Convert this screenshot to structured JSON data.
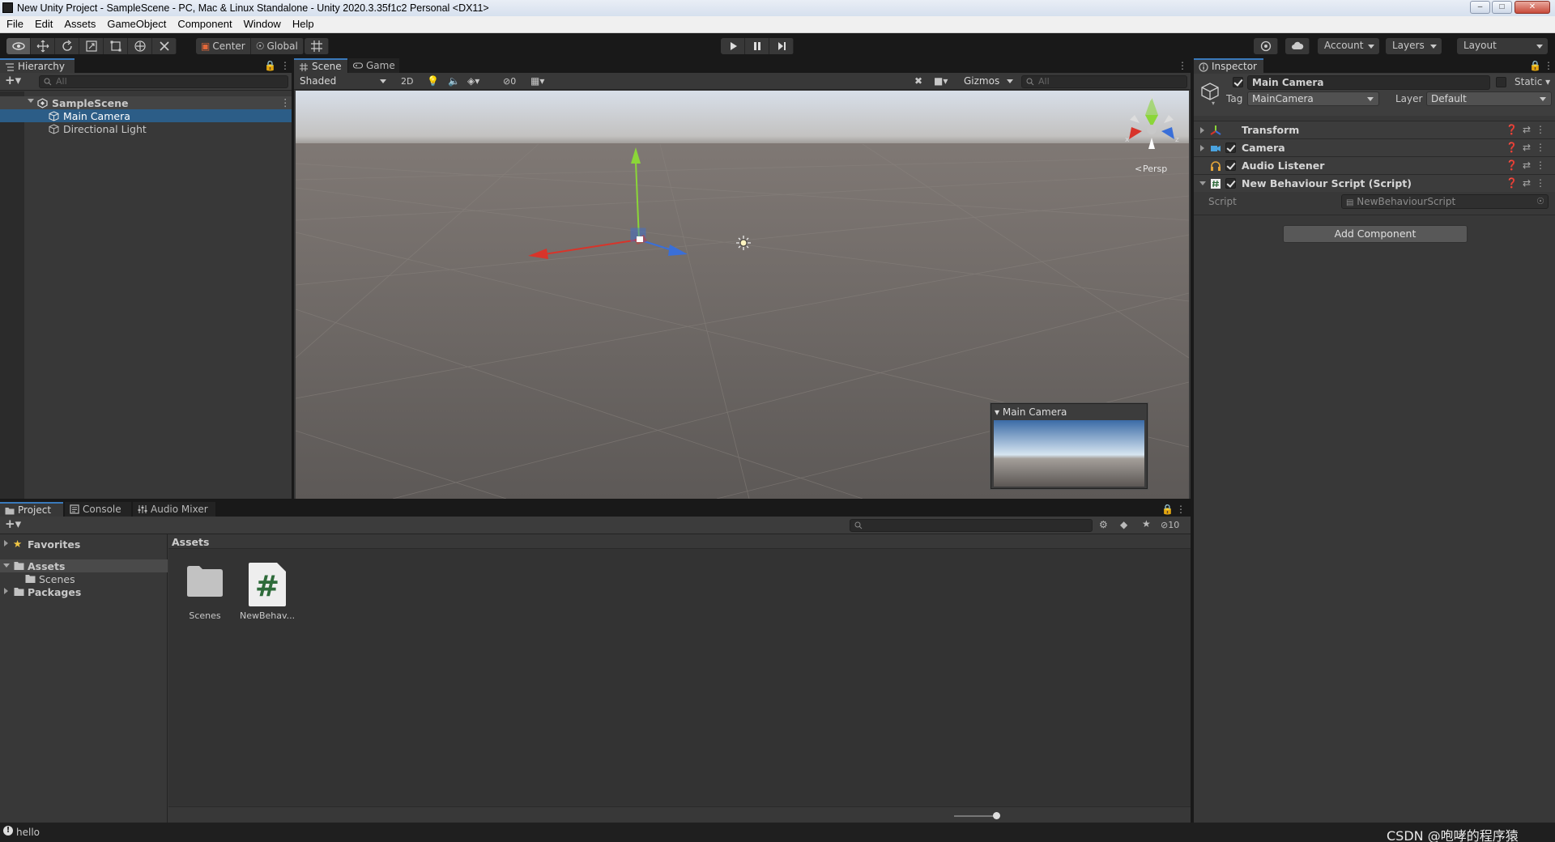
{
  "window": {
    "title": "New Unity Project - SampleScene - PC, Mac & Linux Standalone - Unity 2020.3.35f1c2 Personal <DX11>"
  },
  "menubar": [
    "File",
    "Edit",
    "Assets",
    "GameObject",
    "Component",
    "Window",
    "Help"
  ],
  "toolbar": {
    "pivot_label": "Center",
    "space_label": "Global",
    "account_label": "Account",
    "layers_label": "Layers",
    "layout_label": "Layout"
  },
  "hierarchy": {
    "tab": "Hierarchy",
    "search_placeholder": "All",
    "scene": "SampleScene",
    "items": [
      "Main Camera",
      "Directional Light"
    ],
    "selected": "Main Camera"
  },
  "scene": {
    "tabs": [
      "Scene",
      "Game"
    ],
    "shading": "Shaded",
    "mode_2d": "2D",
    "hidden_count": "0",
    "gizmos": "Gizmos",
    "search_placeholder": "All",
    "projection": "Persp",
    "camera_preview_title": "Main Camera",
    "gizmo_axes": {
      "x": "x",
      "y": "y",
      "z": "z"
    }
  },
  "inspector": {
    "tab": "Inspector",
    "object_name": "Main Camera",
    "static_label": "Static",
    "tag_label": "Tag",
    "tag_value": "MainCamera",
    "layer_label": "Layer",
    "layer_value": "Default",
    "components": [
      "Transform",
      "Camera",
      "Audio Listener",
      "New Behaviour Script (Script)"
    ],
    "script_field_label": "Script",
    "script_field_value": "NewBehaviourScript",
    "add_component": "Add Component"
  },
  "project": {
    "tabs": [
      "Project",
      "Console",
      "Audio Mixer"
    ],
    "hidden_count": "10",
    "tree": {
      "favorites": "Favorites",
      "assets": "Assets",
      "scenes": "Scenes",
      "packages": "Packages"
    },
    "breadcrumb": "Assets",
    "items": [
      "Scenes",
      "NewBehav..."
    ]
  },
  "status": {
    "message": "hello",
    "watermark": "CSDN @咆哮的程序猿"
  },
  "colors": {
    "selection": "#2c5d87",
    "active_tab_accent": "#3a79bb",
    "axis_x": "#d8342a",
    "axis_y": "#8bd638",
    "axis_z": "#3a6fd8"
  }
}
